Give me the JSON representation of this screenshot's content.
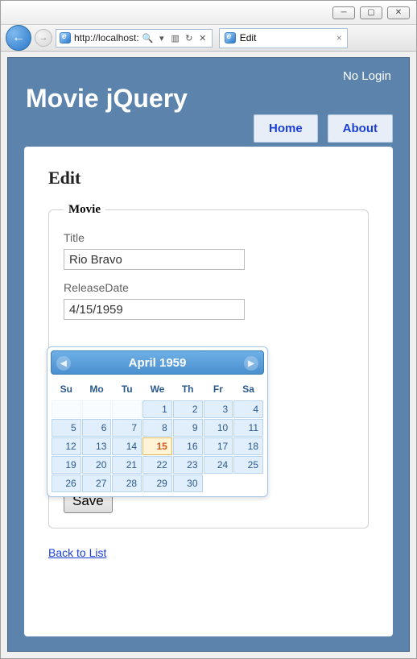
{
  "window": {
    "url": "http://localhost:",
    "search_glyph": "🔍",
    "tab_title": "Edit"
  },
  "header": {
    "login_text": "No Login",
    "app_title": "Movie jQuery",
    "nav": {
      "home": "Home",
      "about": "About"
    }
  },
  "page": {
    "heading": "Edit",
    "legend": "Movie",
    "title_label": "Title",
    "title_value": "Rio Bravo",
    "release_label": "ReleaseDate",
    "release_value": "4/15/1959",
    "save_label": "Save",
    "back_label": "Back to List"
  },
  "datepicker": {
    "header": "April 1959",
    "dow": [
      "Su",
      "Mo",
      "Tu",
      "We",
      "Th",
      "Fr",
      "Sa"
    ],
    "lead_blanks": 3,
    "days": 30,
    "today": 15
  }
}
